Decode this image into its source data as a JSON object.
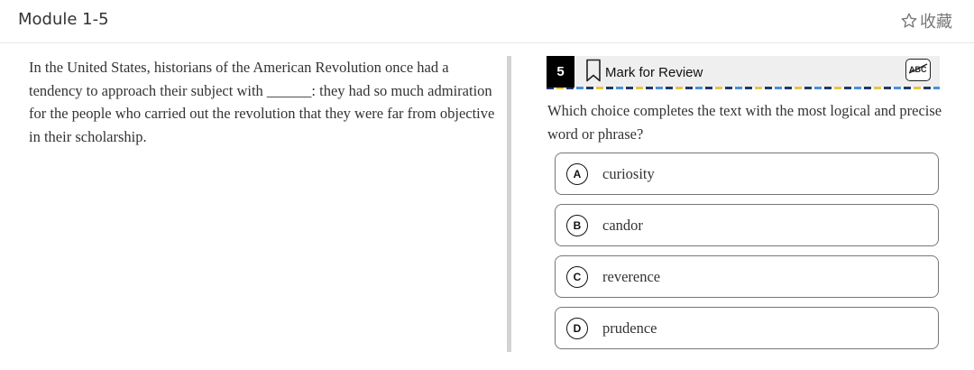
{
  "header": {
    "module_title": "Module 1-5",
    "favorite_label": "收藏",
    "favorite_icon": "star-outline-icon"
  },
  "passage": {
    "text": "In the United States, historians of the American Revolution once had a tendency to approach their subject with ______: they had so much admiration for the people who carried out the revolution that they were far from objective in their scholarship."
  },
  "question": {
    "number": "5",
    "mark_for_review": "Mark for Review",
    "bookmark_icon": "bookmark-icon",
    "abc_icon": "strikethrough-abc-icon",
    "prompt": "Which choice completes the text with the most logical and precise word or phrase?",
    "options": [
      {
        "letter": "A",
        "text": "curiosity"
      },
      {
        "letter": "B",
        "text": "candor"
      },
      {
        "letter": "C",
        "text": "reverence"
      },
      {
        "letter": "D",
        "text": "prudence"
      }
    ]
  },
  "colors": {
    "accent_navy": "#1f3b63",
    "accent_yellow": "#e6c544",
    "accent_blue": "#4a90d9",
    "divider": "#d3d3d3"
  }
}
